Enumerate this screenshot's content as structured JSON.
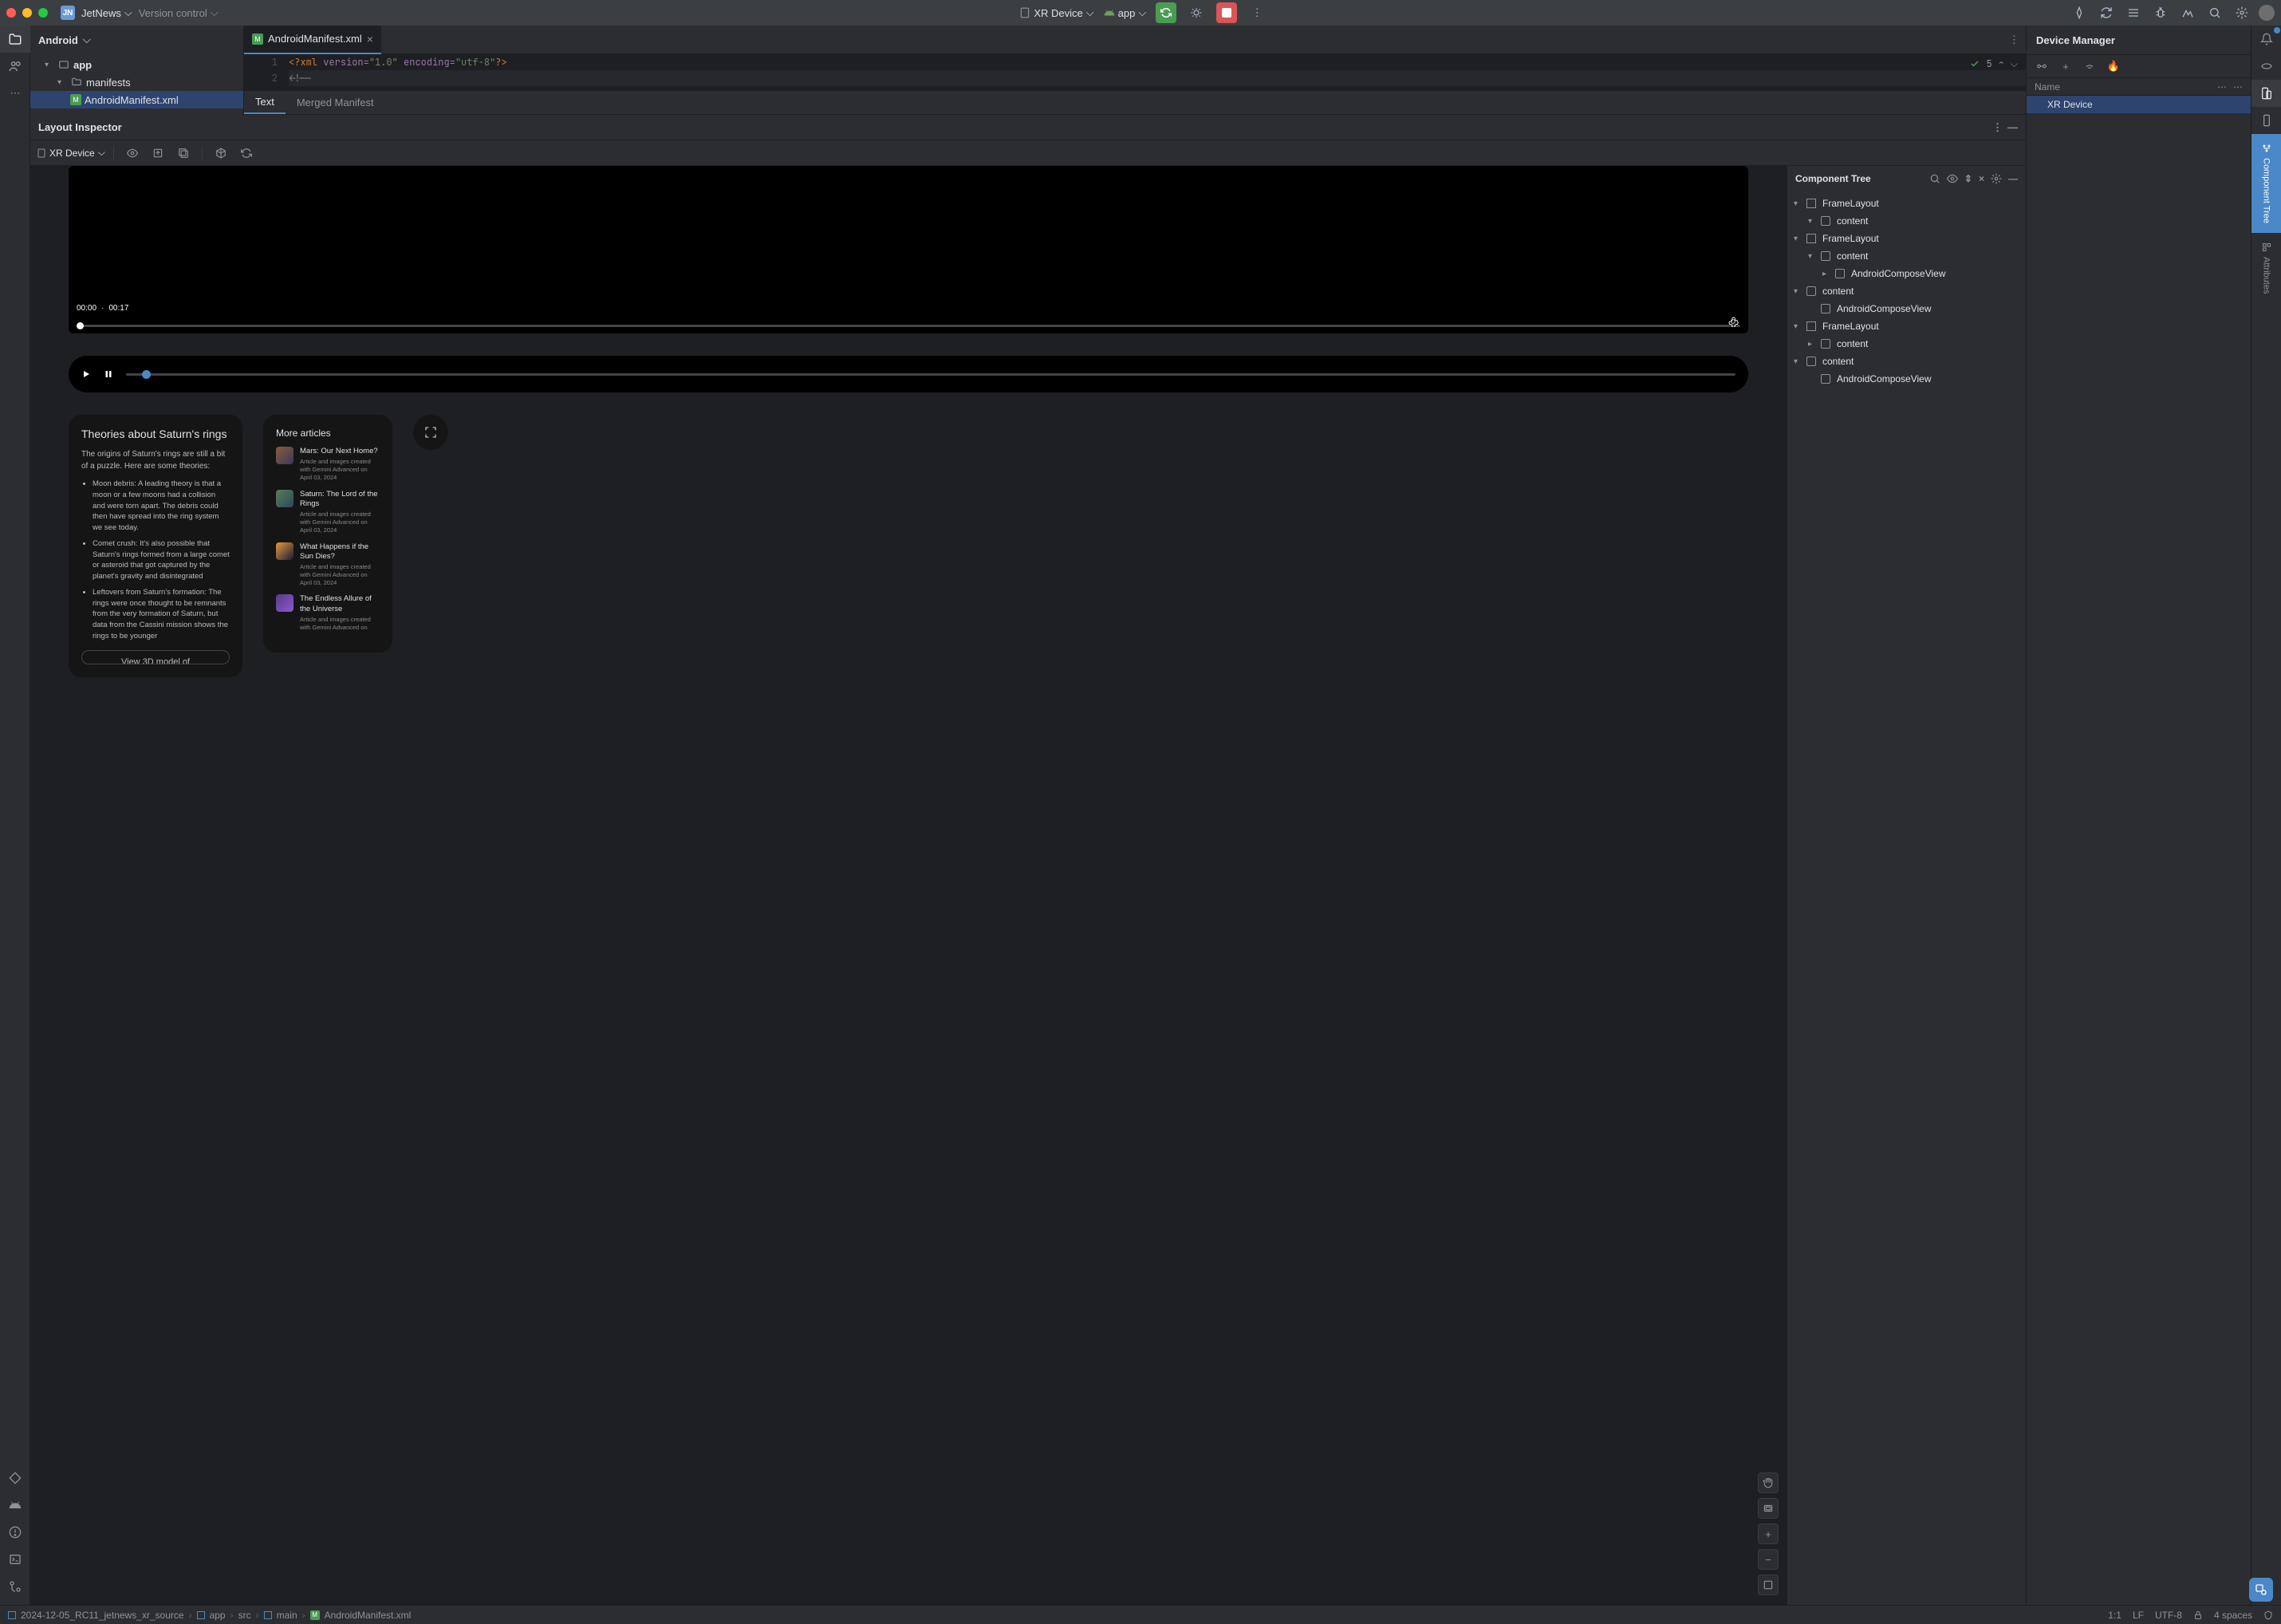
{
  "titlebar": {
    "app_initials": "JN",
    "app_name": "JetNews",
    "vcs_label": "Version control",
    "device_selector": "XR Device",
    "run_config": "app"
  },
  "project_panel": {
    "header": "Android",
    "tree": {
      "root": "app",
      "manifests_folder": "manifests",
      "manifest_file": "AndroidManifest.xml"
    }
  },
  "editor": {
    "tab_label": "AndroidManifest.xml",
    "line1": {
      "num": "1",
      "decl": "<?xml",
      "ver_attr": "version=",
      "ver_val": "\"1.0\"",
      "enc_attr": "encoding=",
      "enc_val": "\"utf-8\"",
      "end": "?>"
    },
    "line2": {
      "num": "2",
      "comment": "<!--"
    },
    "status_count": "5",
    "subtab_text": "Text",
    "subtab_merged": "Merged Manifest"
  },
  "layout_inspector": {
    "title": "Layout Inspector",
    "device": "XR Device"
  },
  "video": {
    "cur": "00:00",
    "sep": "·",
    "dur": "00:17"
  },
  "theories": {
    "heading": "Theories about Saturn's rings",
    "intro": "The origins of Saturn's rings are still a bit of a puzzle. Here are some theories:",
    "b1": "Moon debris: A leading theory is that a moon or a few moons had a collision and were torn apart. The debris could then have spread into the ring system we see today.",
    "b2": "Comet crush: It's also possible that Saturn's rings formed from a large comet or asteroid that got captured by the planet's gravity and disintegrated",
    "b3": "Leftovers from Saturn's formation: The rings were once thought to be remnants from the very formation of Saturn, but data from the Cassini mission shows the rings to be younger",
    "btn": "View 3D model of"
  },
  "articles": {
    "heading": "More articles",
    "items": [
      {
        "title": "Mars: Our Next Home?",
        "meta": "Article and images created with Gemini Advanced on April 03, 2024"
      },
      {
        "title": "Saturn: The Lord of the Rings",
        "meta": "Article and images created with Gemini Advanced on April 03, 2024"
      },
      {
        "title": "What Happens if the Sun Dies?",
        "meta": "Article and images created with Gemini Advanced on April 03, 2024"
      },
      {
        "title": "The Endless Allure of the Universe",
        "meta": "Article and images created with Gemini Advanced on"
      }
    ]
  },
  "component_tree": {
    "header": "Component Tree",
    "items": [
      {
        "label": "FrameLayout",
        "depth": 0,
        "icon": "box",
        "expanded": true
      },
      {
        "label": "content",
        "depth": 1,
        "icon": "square",
        "expanded": true
      },
      {
        "label": "FrameLayout",
        "depth": 0,
        "icon": "box",
        "expanded": true
      },
      {
        "label": "content",
        "depth": 1,
        "icon": "square",
        "expanded": true
      },
      {
        "label": "AndroidComposeView",
        "depth": 2,
        "icon": "square",
        "collapsed": true
      },
      {
        "label": "content",
        "depth": 0,
        "icon": "square",
        "expanded": true
      },
      {
        "label": "AndroidComposeView",
        "depth": 1,
        "icon": "square"
      },
      {
        "label": "FrameLayout",
        "depth": 0,
        "icon": "box",
        "expanded": true
      },
      {
        "label": "content",
        "depth": 1,
        "icon": "square",
        "collapsed": true
      },
      {
        "label": "content",
        "depth": 0,
        "icon": "square",
        "expanded": true
      },
      {
        "label": "AndroidComposeView",
        "depth": 1,
        "icon": "square"
      }
    ]
  },
  "device_manager": {
    "title": "Device Manager",
    "col_name": "Name",
    "device": "XR Device"
  },
  "right_tabs": {
    "comp_tree": "Component Tree",
    "attributes": "Attributes"
  },
  "statusbar": {
    "crumbs": [
      "2024-12-05_RC11_jetnews_xr_source",
      "app",
      "src",
      "main",
      "AndroidManifest.xml"
    ],
    "pos": "1:1",
    "sep": "LF",
    "enc": "UTF-8",
    "indent": "4 spaces"
  }
}
